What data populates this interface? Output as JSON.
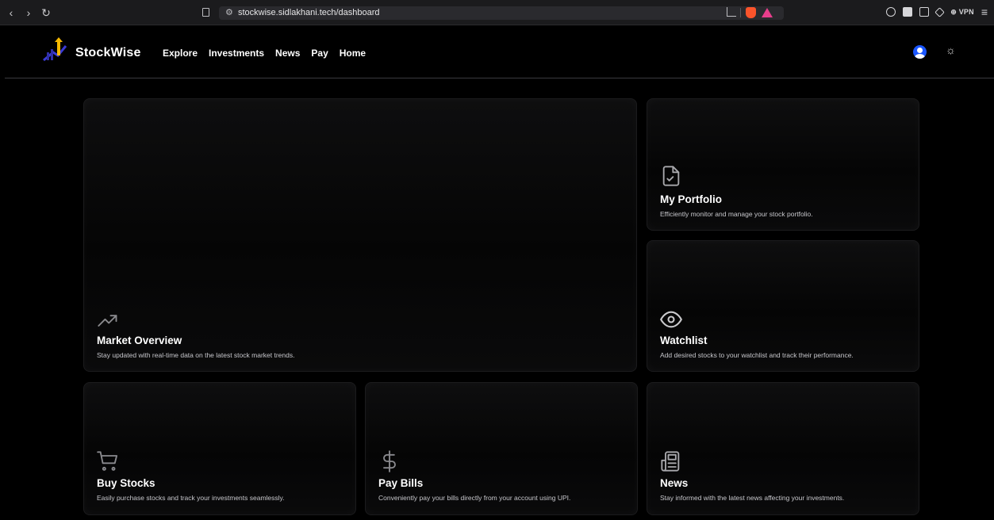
{
  "browser": {
    "url": "stockwise.sidlakhani.tech/dashboard",
    "vpn_label": "VPN"
  },
  "header": {
    "brand": "StockWise",
    "nav": [
      "Explore",
      "Investments",
      "News",
      "Pay",
      "Home"
    ]
  },
  "cards": {
    "market": {
      "title": "Market Overview",
      "desc": "Stay updated with real-time data on the latest stock market trends.",
      "icon": "trending-up-icon"
    },
    "portfolio": {
      "title": "My Portfolio",
      "desc": "Efficiently monitor and manage your stock portfolio.",
      "icon": "file-check-icon"
    },
    "watchlist": {
      "title": "Watchlist",
      "desc": "Add desired stocks to your watchlist and track their performance.",
      "icon": "eye-icon"
    },
    "buy": {
      "title": "Buy Stocks",
      "desc": "Easily purchase stocks and track your investments seamlessly.",
      "icon": "shopping-cart-icon"
    },
    "pay": {
      "title": "Pay Bills",
      "desc": "Conveniently pay your bills directly from your account using UPI.",
      "icon": "dollar-icon"
    },
    "news": {
      "title": "News",
      "desc": "Stay informed with the latest news affecting your investments.",
      "icon": "newspaper-icon"
    }
  }
}
